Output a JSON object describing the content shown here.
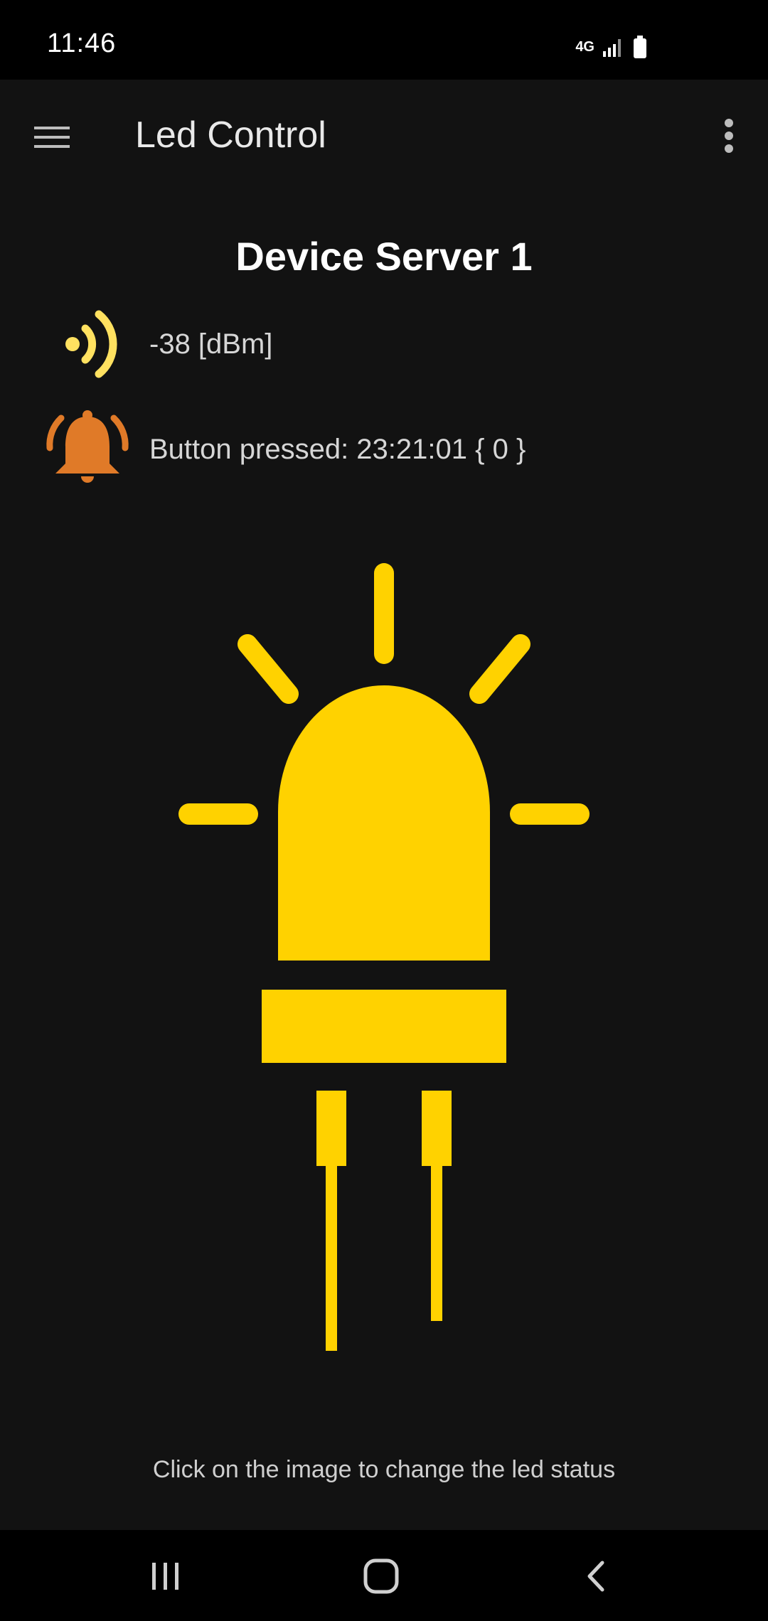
{
  "status_bar": {
    "time": "11:46",
    "network": "4G",
    "icons": [
      "network-4g-icon",
      "signal-icon",
      "battery-icon"
    ]
  },
  "app_bar": {
    "title": "Led Control",
    "icons": [
      "hamburger-menu-icon",
      "overflow-menu-icon"
    ]
  },
  "device": {
    "name": "Device Server 1",
    "signal": "-38 [dBm]",
    "button_status": "Button pressed: 23:21:01 { 0 }"
  },
  "led": {
    "icon": "led-on-icon",
    "color": "#FFD200"
  },
  "hint": "Click on the image to change the led status",
  "colors": {
    "background": "#121212",
    "signal_icon": "#FFE160",
    "bell_icon": "#E07A28",
    "led": "#FFD200"
  },
  "nav_bar": {
    "icons": [
      "recent-apps-icon",
      "home-icon",
      "back-icon"
    ]
  }
}
